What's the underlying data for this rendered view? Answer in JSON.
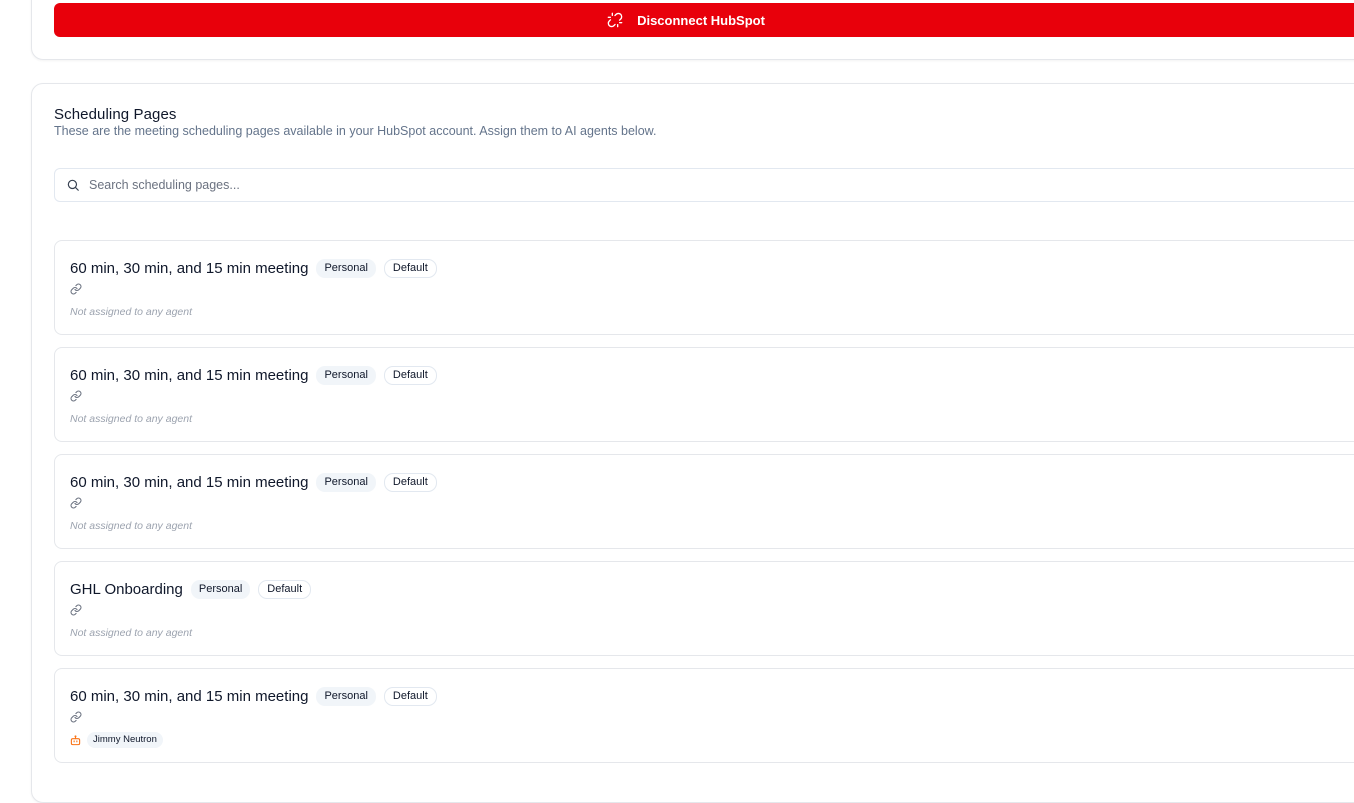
{
  "disconnect": {
    "label": "Disconnect HubSpot",
    "color": "#e8000b",
    "icon": "unlink-icon"
  },
  "scheduling": {
    "title": "Scheduling Pages",
    "description": "These are the meeting scheduling pages available in your HubSpot account. Assign them to AI agents below.",
    "search_placeholder": "Search scheduling pages..."
  },
  "pages": [
    {
      "title": "60 min, 30 min, and 15 min meeting",
      "badge_personal": "Personal",
      "badge_default": "Default",
      "assignment": "Not assigned to any agent"
    },
    {
      "title": "60 min, 30 min, and 15 min meeting",
      "badge_personal": "Personal",
      "badge_default": "Default",
      "assignment": "Not assigned to any agent"
    },
    {
      "title": "60 min, 30 min, and 15 min meeting",
      "badge_personal": "Personal",
      "badge_default": "Default",
      "assignment": "Not assigned to any agent"
    },
    {
      "title": "GHL Onboarding",
      "badge_personal": "Personal",
      "badge_default": "Default",
      "assignment": "Not assigned to any agent"
    },
    {
      "title": "60 min, 30 min, and 15 min meeting",
      "badge_personal": "Personal",
      "badge_default": "Default",
      "agent": "Jimmy Neutron",
      "agent_icon_color": "#f97316"
    }
  ]
}
